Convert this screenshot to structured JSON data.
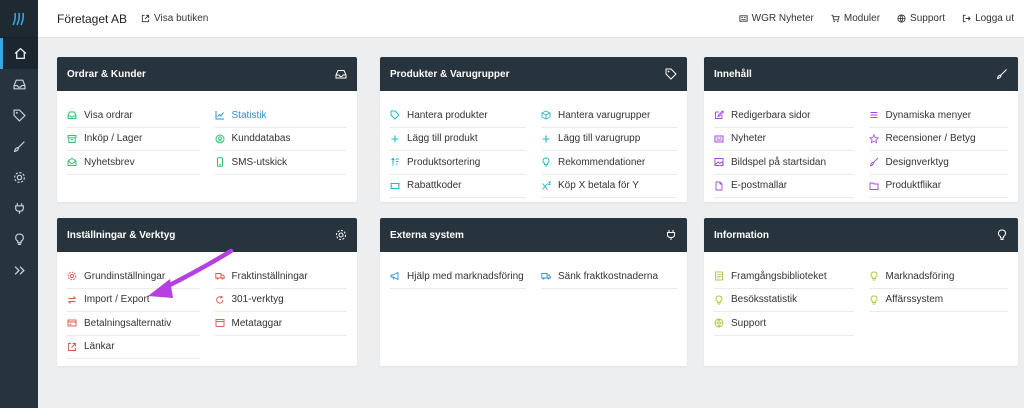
{
  "topbar": {
    "company": "Företaget AB",
    "visit_store": "Visa butiken",
    "links": [
      "WGR Nyheter",
      "Moduler",
      "Support",
      "Logga ut"
    ]
  },
  "sidebar_icons": [
    "logo-icon",
    "home-icon",
    "inbox-icon",
    "tag-icon",
    "brush-icon",
    "gear-icon",
    "plug-icon",
    "lightbulb-icon",
    "chevrons-right-icon"
  ],
  "cards": {
    "orders": {
      "title": "Ordrar & Kunder",
      "col1": [
        "Visa ordrar",
        "Inköp / Lager",
        "Nyhetsbrev"
      ],
      "col2": [
        "Statistik",
        "Kunddatabas",
        "SMS-utskick"
      ]
    },
    "products": {
      "title": "Produkter & Varugrupper",
      "col1": [
        "Hantera produkter",
        "Lägg till produkt",
        "Produktsortering",
        "Rabattkoder"
      ],
      "col2": [
        "Hantera varugrupper",
        "Lägg till varugrupp",
        "Rekommendationer",
        "Köp X betala för Y"
      ]
    },
    "content": {
      "title": "Innehåll",
      "col1": [
        "Redigerbara sidor",
        "Nyheter",
        "Bildspel på startsidan",
        "E-postmallar"
      ],
      "col2": [
        "Dynamiska menyer",
        "Recensioner / Betyg",
        "Designverktyg",
        "Produktflikar"
      ]
    },
    "settings": {
      "title": "Inställningar & Verktyg",
      "col1": [
        "Grundinställningar",
        "Import / Export",
        "Betalningsalternativ",
        "Länkar"
      ],
      "col2": [
        "Fraktinställningar",
        "301-verktyg",
        "Metataggar"
      ]
    },
    "external": {
      "title": "Externa system",
      "col1": [
        "Hjälp med marknadsföring"
      ],
      "col2": [
        "Sänk fraktkostnaderna"
      ]
    },
    "info": {
      "title": "Information",
      "col1": [
        "Framgångsbiblioteket",
        "Besöksstatistik",
        "Support"
      ],
      "col2": [
        "Marknadsföring",
        "Affärssystem"
      ]
    }
  },
  "colors": {
    "sidebar_bg": "#27333d",
    "card_header_bg": "#27333d",
    "accent_green": "#2fbf71",
    "accent_cyan": "#22b7c9",
    "accent_purple": "#a34bd6",
    "accent_red": "#e2504a",
    "accent_yellowgreen": "#a8c93a",
    "annotation_arrow": "#b53fe0"
  }
}
